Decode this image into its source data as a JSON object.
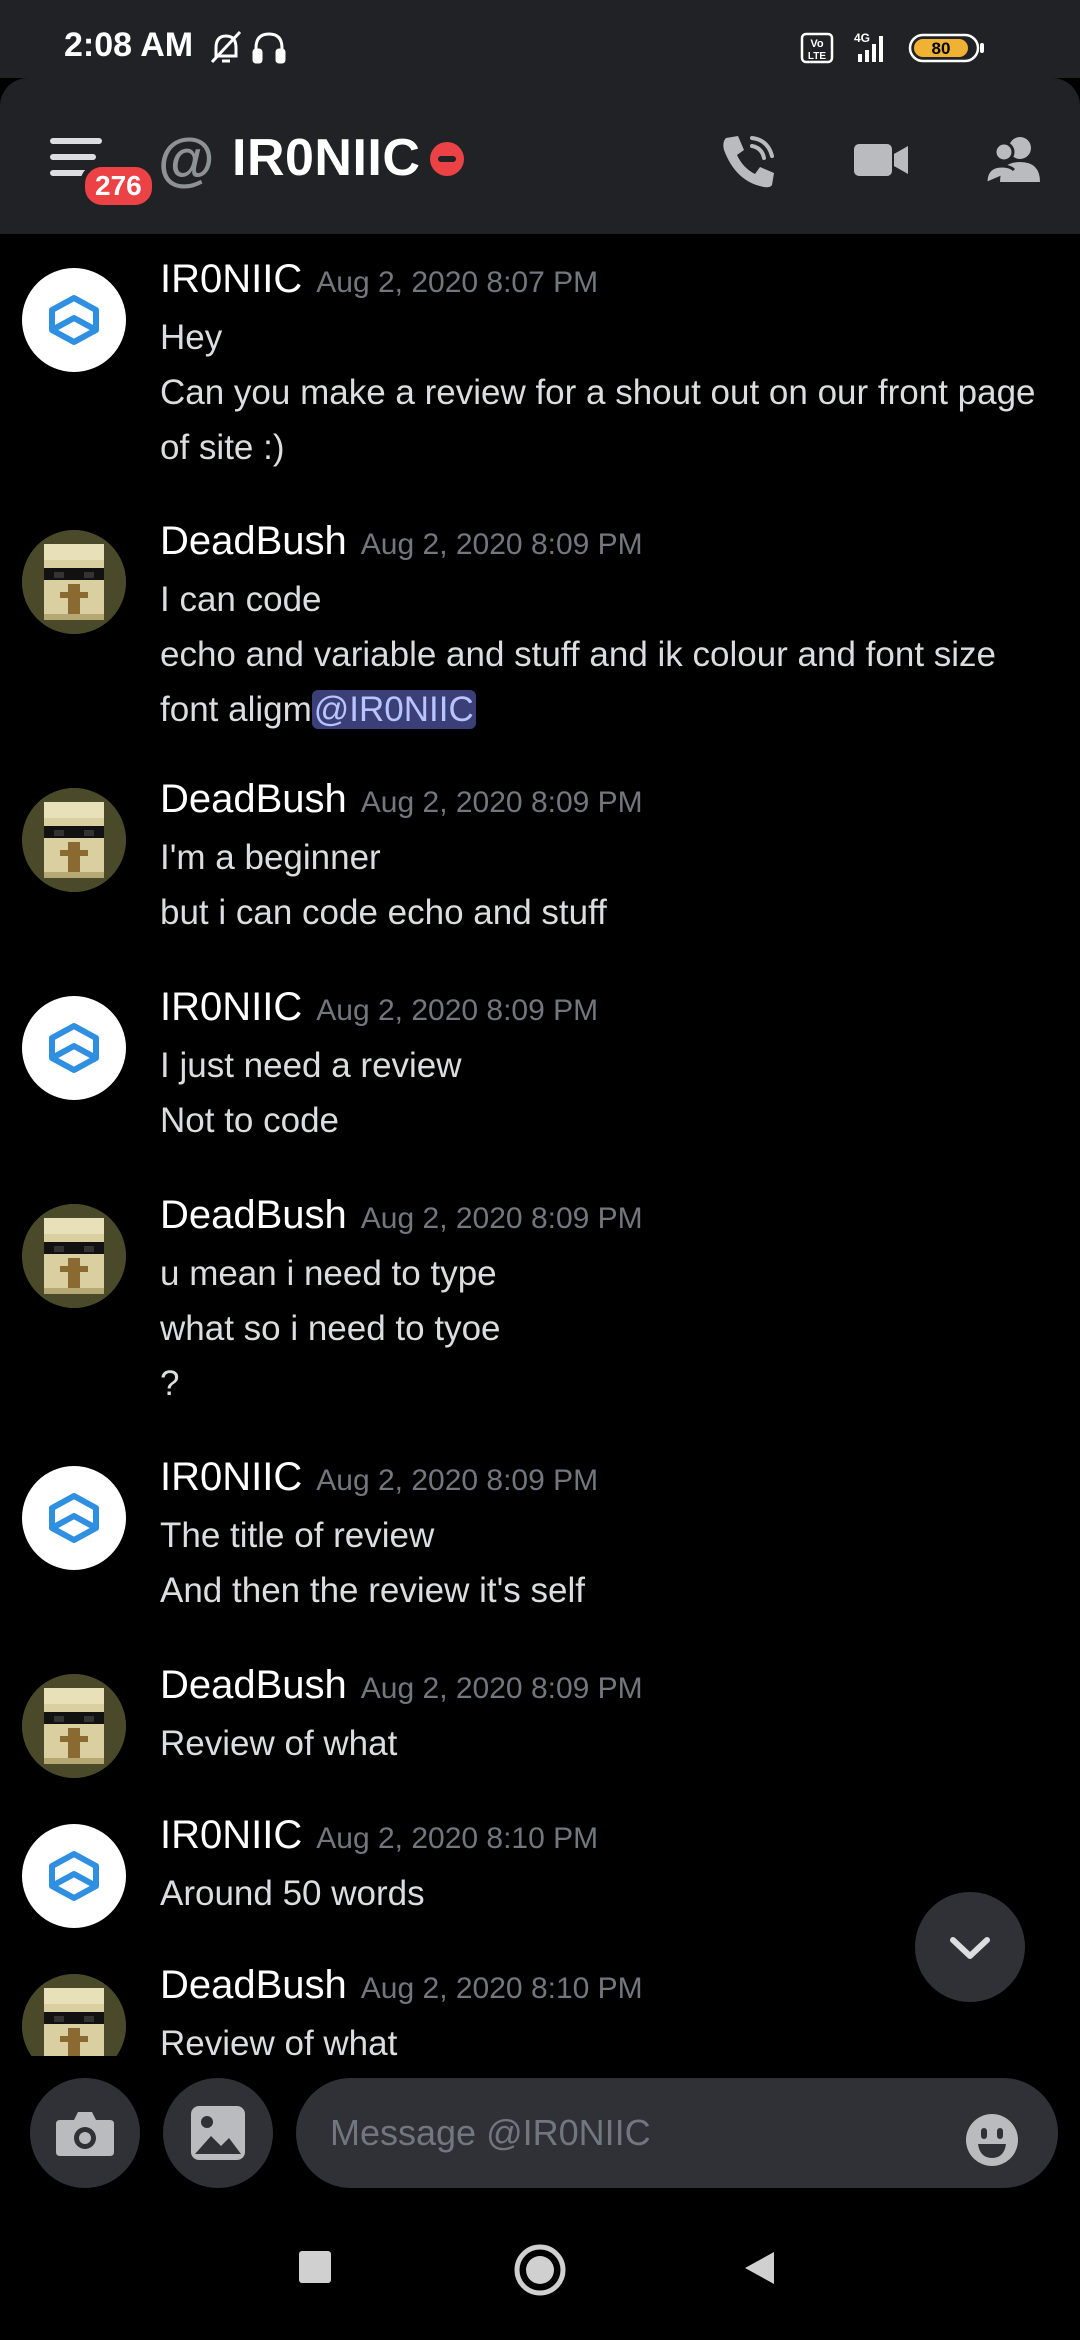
{
  "status_bar": {
    "time": "2:08 AM",
    "volte_label": "Vo LTE",
    "network": "4G",
    "battery": "80"
  },
  "header": {
    "menu_badge": "276",
    "title": "IR0NIIC",
    "status": "dnd",
    "icons": [
      "menu-icon",
      "at-icon",
      "dnd-status-icon",
      "voice-call-icon",
      "video-call-icon",
      "member-list-icon"
    ]
  },
  "messages": [
    {
      "author": "IR0NIIC",
      "timestamp": "Aug 2, 2020 8:07 PM",
      "avatar": "logo",
      "lines": [
        "Hey",
        "Can you make a review for a shout out on our front page",
        "of site :)"
      ]
    },
    {
      "author": "DeadBush",
      "timestamp": "Aug 2, 2020 8:09 PM",
      "avatar": "minecraft",
      "lines": [
        "I can code",
        "echo and variable and stuff and ik colour and font size"
      ],
      "mention_line": {
        "text": "font aligm",
        "mention": "@IR0NIIC"
      }
    },
    {
      "author": "DeadBush",
      "timestamp": "Aug 2, 2020 8:09 PM",
      "avatar": "minecraft",
      "lines": [
        "I'm a beginner",
        "but i can code echo and stuff"
      ]
    },
    {
      "author": "IR0NIIC",
      "timestamp": "Aug 2, 2020 8:09 PM",
      "avatar": "logo",
      "lines": [
        "I just need a review",
        "Not to code"
      ]
    },
    {
      "author": "DeadBush",
      "timestamp": "Aug 2, 2020 8:09 PM",
      "avatar": "minecraft",
      "lines": [
        "u mean i need to type",
        "what so i need to tyoe",
        "?"
      ]
    },
    {
      "author": "IR0NIIC",
      "timestamp": "Aug 2, 2020 8:09 PM",
      "avatar": "logo",
      "lines": [
        "The title of review",
        "And then the review it's self"
      ]
    },
    {
      "author": "DeadBush",
      "timestamp": "Aug 2, 2020 8:09 PM",
      "avatar": "minecraft",
      "lines": [
        "Review of what"
      ]
    },
    {
      "author": "IR0NIIC",
      "timestamp": "Aug 2, 2020 8:10 PM",
      "avatar": "logo",
      "lines": [
        "Around 50 words"
      ]
    },
    {
      "author": "DeadBush",
      "timestamp": "Aug 2, 2020 8:10 PM",
      "avatar": "minecraft",
      "lines": [
        "Review of what"
      ]
    }
  ],
  "input": {
    "placeholder": "Message @IR0NIIC",
    "camera_icon": "camera-icon",
    "gallery_icon": "image-icon",
    "emoji_icon": "emoji-icon"
  },
  "colors": {
    "background": "#000000",
    "header": "#202225",
    "text": "#dcddde",
    "timestamp": "#72767d",
    "mention_bg": "#3b3f78",
    "badge": "#ed4245"
  }
}
